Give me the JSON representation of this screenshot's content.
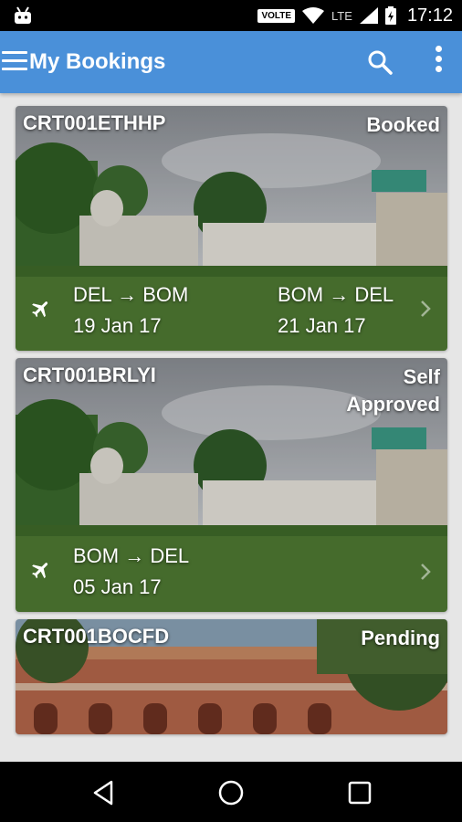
{
  "status_bar": {
    "time": "17:12",
    "volte": "VOLTE",
    "network": "LTE"
  },
  "app_bar": {
    "title": "My Bookings",
    "accent": "#4a90d9"
  },
  "bookings": [
    {
      "ref": "CRT001ETHHP",
      "status": "Booked",
      "legs": [
        {
          "route": "DEL → BOM",
          "date": "19 Jan 17"
        },
        {
          "route": "BOM → DEL",
          "date": "21 Jan 17"
        }
      ]
    },
    {
      "ref": "CRT001BRLYI",
      "status_line1": "Self",
      "status_line2": "Approved",
      "legs": [
        {
          "route": "BOM → DEL",
          "date": "05 Jan 17"
        }
      ]
    },
    {
      "ref": "CRT001BOCFD",
      "status": "Pending"
    }
  ],
  "icons": {
    "menu": "menu-icon",
    "search": "search-icon",
    "more": "more-vert-icon",
    "plane": "flight-icon",
    "chevron": "chevron-right-icon"
  }
}
